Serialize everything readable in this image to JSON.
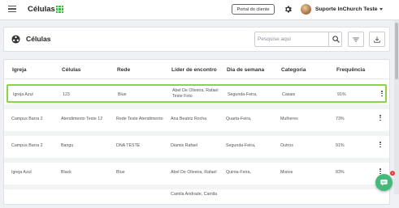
{
  "app": {
    "title": "Células"
  },
  "topbar": {
    "portal_label": "Portal do cliente",
    "user_name": "Suporte InChurch Teste"
  },
  "page": {
    "section_title": "Células",
    "search_placeholder": "Pesquise aqui"
  },
  "table": {
    "headers": [
      "Igreja",
      "Células",
      "Rede",
      "Líder de encontro",
      "Dia de semana",
      "Categoria",
      "Frequência"
    ],
    "rows": [
      {
        "igreja": "Igreja Azul",
        "celula": "123",
        "rede": "Blue",
        "lider1": "Abel De Oliveira, Rafael",
        "lider2": "Teste Foto",
        "dia": "Segunda-Feira,",
        "categoria": "Casais",
        "frequencia": "91%",
        "selected": true
      },
      {
        "igreja": "Campus Barra 2",
        "celula": "Atendimento Teste 12",
        "rede": "Rede Teste Atendimento",
        "lider1": "Ana Beatriz Rocha",
        "lider2": "",
        "dia": "Quarta-Feira,",
        "categoria": "Mulheres",
        "frequencia": "73%"
      },
      {
        "igreja": "Campus Barra 2",
        "celula": "Bangu",
        "rede": "DNA TESTE",
        "lider1": "Diamis Rafael",
        "lider2": "",
        "dia": "Segunda-Feira,",
        "categoria": "Outros",
        "frequencia": "91%"
      },
      {
        "igreja": "Igreja Azul",
        "celula": "Black",
        "rede": "Blue",
        "lider1": "Abel De Oliveira, Rafael",
        "lider2": "",
        "dia": "Quinta-Feira,",
        "categoria": "Mistos",
        "frequencia": "83%"
      },
      {
        "igreja": "",
        "celula": "",
        "rede": "",
        "lider1": "Camila Andrade, Camila",
        "lider2": "",
        "dia": "",
        "categoria": "",
        "frequencia": ""
      }
    ]
  },
  "chat": {
    "badge": "1"
  },
  "colors": {
    "accent_green": "#8bd44a",
    "fab_green": "#45b97c",
    "grid_icon_green": "#4caf50"
  }
}
